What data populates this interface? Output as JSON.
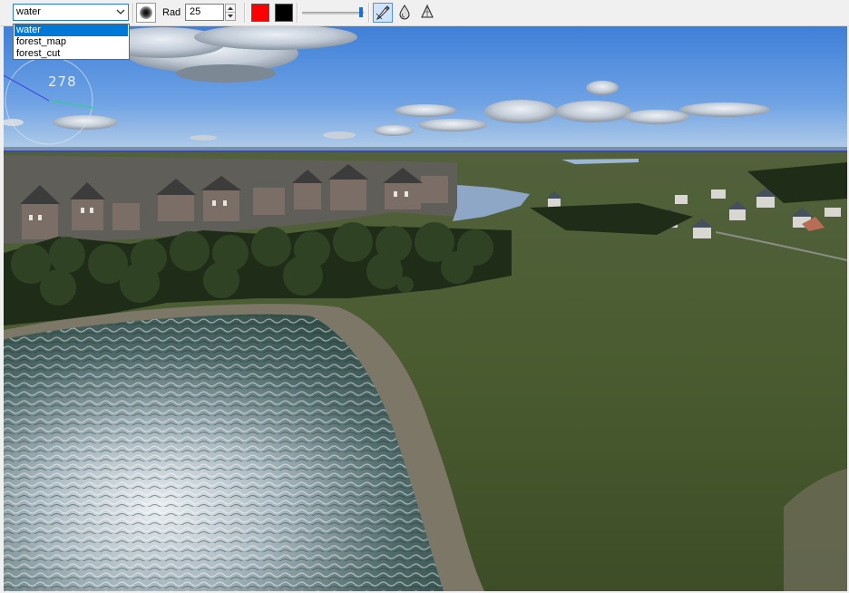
{
  "toolbar": {
    "layer_select": {
      "value": "water"
    },
    "radius": {
      "label": "Rad",
      "value": "25"
    },
    "colors": {
      "primary": "#ff0000",
      "secondary": "#000000"
    },
    "opacity_slider": {
      "level": 0.95
    },
    "icons": [
      "soft-brush-icon",
      "chevron-down-icon",
      "spin-up-icon",
      "spin-down-icon",
      "pencil-icon",
      "water-drop-icon",
      "cone-icon"
    ]
  },
  "dropdown": {
    "options": [
      "water",
      "forest_map",
      "forest_cut"
    ],
    "selected": "water"
  },
  "viewport": {
    "compass_heading": "278"
  }
}
